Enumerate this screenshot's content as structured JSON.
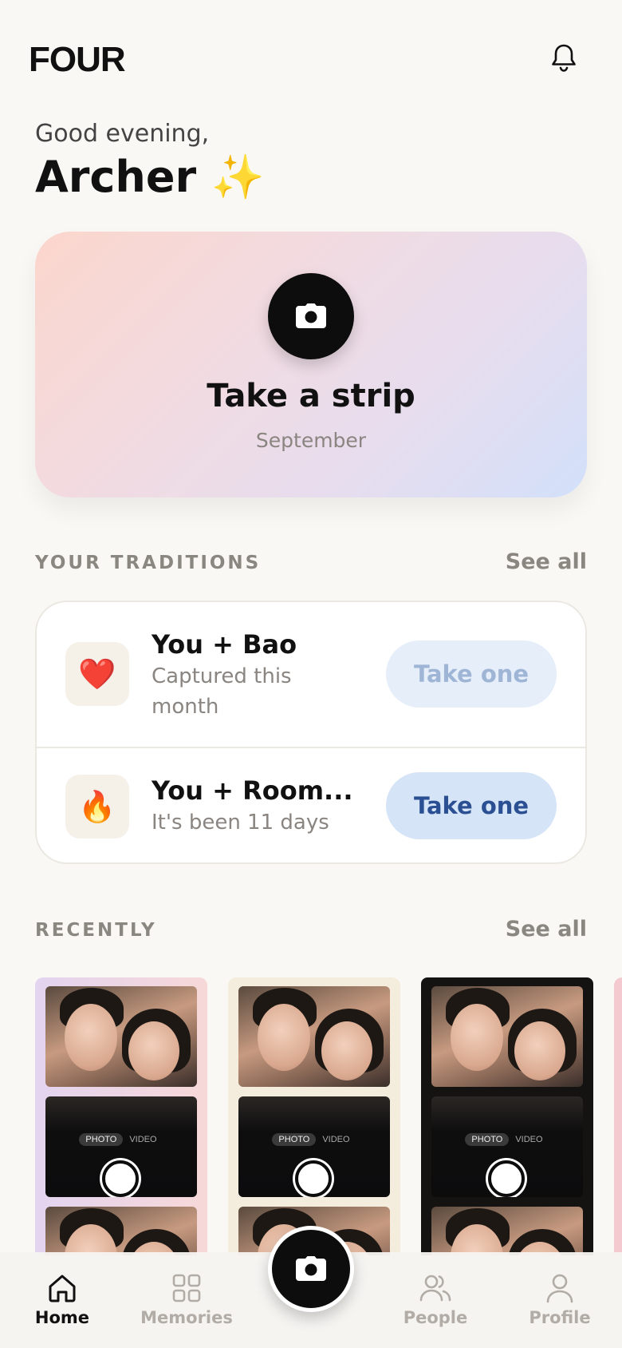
{
  "header": {
    "logo": "FOUR",
    "notification_icon": "bell-icon"
  },
  "greeting": {
    "salutation": "Good evening,",
    "name": "Archer ✨"
  },
  "hero": {
    "icon": "camera-icon",
    "title": "Take a strip",
    "subtitle": "September"
  },
  "traditions": {
    "label": "YOUR TRADITIONS",
    "see_all": "See all",
    "items": [
      {
        "emoji": "❤️",
        "title": "You + Bao",
        "subtitle": "Captured this month",
        "action": "Take one",
        "action_state": "disabled"
      },
      {
        "emoji": "🔥",
        "title": "You + Room...",
        "subtitle": "It's been 11 days",
        "action": "Take one",
        "action_state": "enabled"
      }
    ]
  },
  "recently": {
    "label": "RECENTLY",
    "see_all": "See all",
    "camera_modes": [
      "PHOTO",
      "VIDEO"
    ]
  },
  "tabbar": {
    "tabs": [
      {
        "label": "Home",
        "icon": "home-icon",
        "active": true
      },
      {
        "label": "Memories",
        "icon": "grid-icon",
        "active": false
      },
      {
        "label": "People",
        "icon": "people-icon",
        "active": false
      },
      {
        "label": "Profile",
        "icon": "person-icon",
        "active": false
      }
    ],
    "center_button_icon": "camera-icon"
  },
  "colors": {
    "background": "#f9f8f4",
    "accent_button": "#d6e4f7",
    "accent_text": "#2a4f92",
    "hero_gradient_start": "#fbd6cc",
    "hero_gradient_end": "#d2e0fa"
  }
}
